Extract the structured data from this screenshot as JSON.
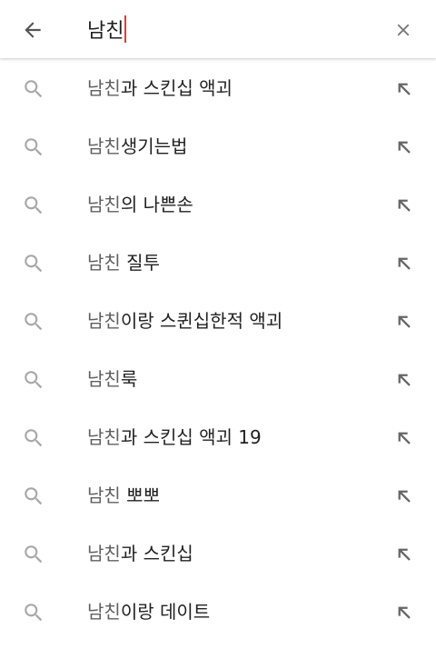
{
  "search": {
    "query": "남친",
    "back_icon": "arrow-back-icon",
    "clear_icon": "close-icon"
  },
  "colors": {
    "caret": "#e53935",
    "matched_prefix": "#606060",
    "completion_text": "#212121",
    "icon": "#9e9e9e"
  },
  "suggestions": [
    {
      "prefix": "남친",
      "rest": "과 스킨십 액괴"
    },
    {
      "prefix": "남친",
      "rest": "생기는법"
    },
    {
      "prefix": "남친",
      "rest": "의 나쁜손"
    },
    {
      "prefix": "남친",
      "rest": " 질투"
    },
    {
      "prefix": "남친",
      "rest": "이랑 스퀸십한적 액괴"
    },
    {
      "prefix": "남친",
      "rest": "룩"
    },
    {
      "prefix": "남친",
      "rest": "과 스킨십 액괴 19"
    },
    {
      "prefix": "남친",
      "rest": " 뽀뽀"
    },
    {
      "prefix": "남친",
      "rest": "과 스킨십"
    },
    {
      "prefix": "남친",
      "rest": "이랑 데이트"
    }
  ],
  "suggestion_icons": {
    "leading": "search-icon",
    "trailing": "arrow-up-left-icon"
  }
}
